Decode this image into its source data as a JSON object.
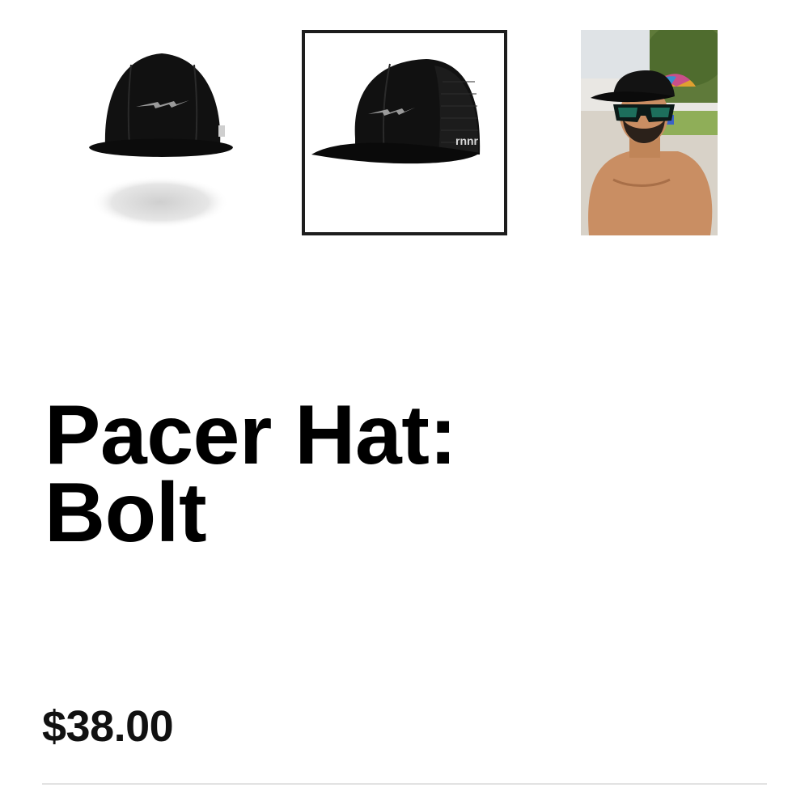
{
  "gallery": {
    "thumbnails": [
      {
        "label": "Front view of black cap",
        "icon": "cap-front-image",
        "selected": false
      },
      {
        "label": "Side view of black cap",
        "icon": "cap-side-image",
        "selected": true,
        "logo_text": "rnnr"
      },
      {
        "label": "Runner wearing cap",
        "icon": "model-photo-image",
        "selected": false
      }
    ]
  },
  "product": {
    "title_line1": "Pacer Hat:",
    "title_line2": "Bolt",
    "price": "$38.00"
  },
  "colors": {
    "text": "#000000",
    "selected_border": "#1d1d1d",
    "divider": "#e2e2e2",
    "cap": "#111111",
    "bolt": "#9a9a9a"
  }
}
